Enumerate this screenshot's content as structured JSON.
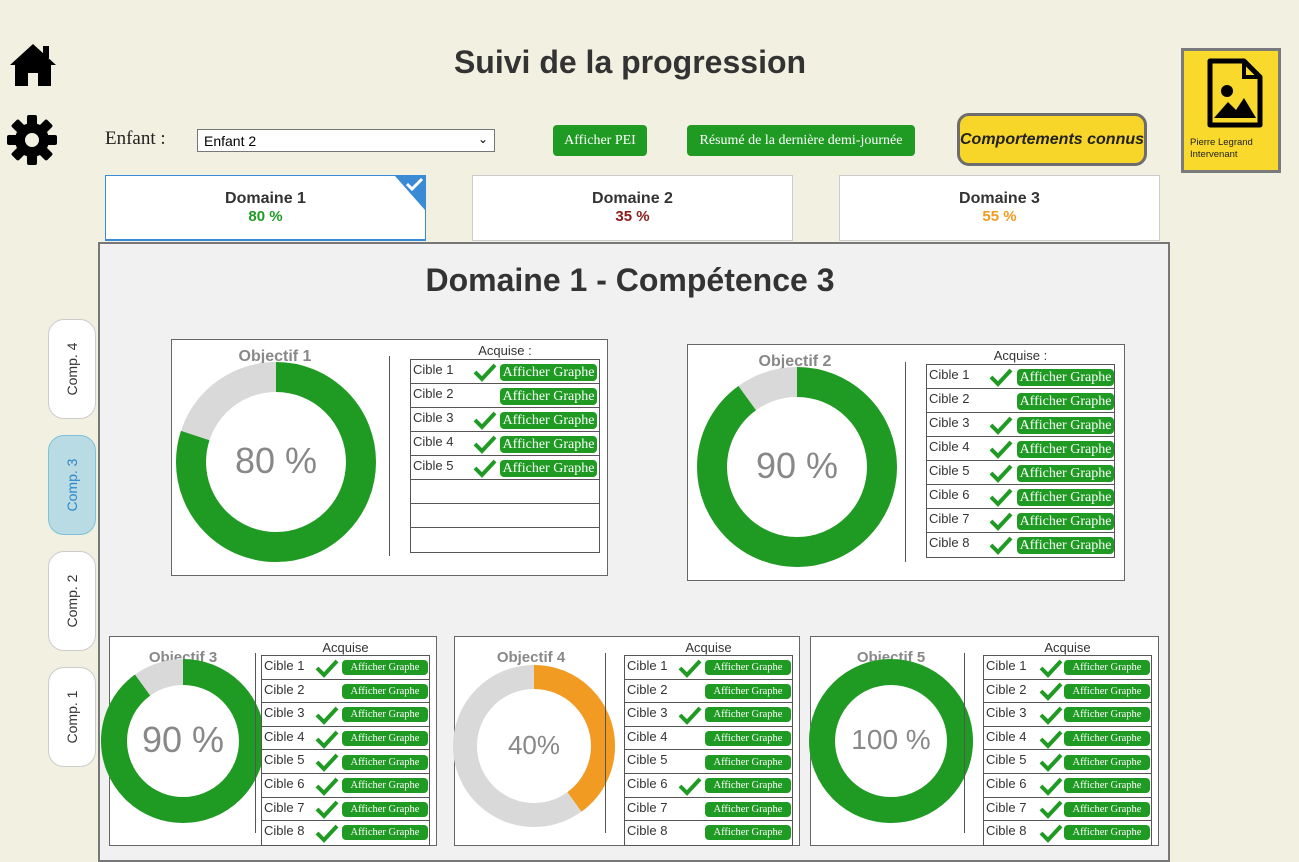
{
  "header": {
    "title": "Suivi de la progression",
    "enfant_label": "Enfant :",
    "enfant_value": "Enfant 2",
    "btn_pei": "Afficher PEI",
    "btn_resume": "Résumé de la dernière demi-journée",
    "btn_comport": "Comportements connus",
    "user_name": "Pierre Legrand",
    "user_role": "Intervenant"
  },
  "domains": [
    {
      "name": "Domaine 1",
      "pct": "80 %",
      "color": "#1f9b23"
    },
    {
      "name": "Domaine 2",
      "pct": "35 %",
      "color": "#8b1a1a"
    },
    {
      "name": "Domaine 3",
      "pct": "55 %",
      "color": "#f29b22"
    }
  ],
  "section_title": "Domaine 1 - Compétence 3",
  "comps": [
    "Comp. 4",
    "Comp. 3",
    "Comp. 2",
    "Comp. 1"
  ],
  "acq_label": "Acquise :",
  "acq_label_short": "Acquise",
  "btn_graph": "Afficher Graphe",
  "objectives": [
    {
      "title": "Objectif 1",
      "pct": "80 %",
      "value": 0.8,
      "color": "#1f9b23",
      "cibles": [
        "Cible 1",
        "Cible 2",
        "Cible 3",
        "Cible 4",
        "Cible 5"
      ],
      "acquired": [
        true,
        false,
        true,
        true,
        true
      ]
    },
    {
      "title": "Objectif 2",
      "pct": "90 %",
      "value": 0.9,
      "color": "#1f9b23",
      "cibles": [
        "Cible 1",
        "Cible 2",
        "Cible 3",
        "Cible 4",
        "Cible 5",
        "Cible 6",
        "Cible 7",
        "Cible 8"
      ],
      "acquired": [
        true,
        false,
        true,
        true,
        true,
        true,
        true,
        true
      ]
    },
    {
      "title": "Objectif 3",
      "pct": "90 %",
      "value": 0.9,
      "color": "#1f9b23",
      "cibles": [
        "Cible 1",
        "Cible 2",
        "Cible 3",
        "Cible 4",
        "Cible 5",
        "Cible 6",
        "Cible 7",
        "Cible 8"
      ],
      "acquired": [
        true,
        false,
        true,
        true,
        true,
        true,
        true,
        true
      ]
    },
    {
      "title": "Objectif 4",
      "pct": "40%",
      "value": 0.4,
      "color": "#f29b22",
      "cibles": [
        "Cible 1",
        "Cible 2",
        "Cible 3",
        "Cible 4",
        "Cible 5",
        "Cible 6",
        "Cible 7",
        "Cible 8"
      ],
      "acquired": [
        true,
        false,
        true,
        false,
        false,
        true,
        false,
        false
      ]
    },
    {
      "title": "Objectif 5",
      "pct": "100 %",
      "value": 1.0,
      "color": "#1f9b23",
      "cibles": [
        "Cible 1",
        "Cible 2",
        "Cible 3",
        "Cible 4",
        "Cible 5",
        "Cible 6",
        "Cible 7",
        "Cible 8"
      ],
      "acquired": [
        true,
        true,
        true,
        true,
        true,
        true,
        true,
        true
      ]
    }
  ]
}
